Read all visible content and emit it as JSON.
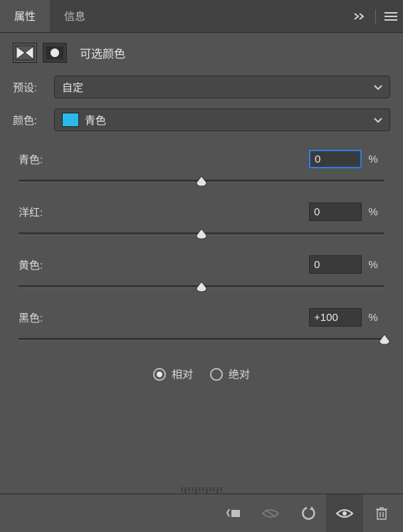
{
  "tabs": {
    "properties": "属性",
    "info": "信息"
  },
  "header": {
    "title": "可选颜色"
  },
  "preset": {
    "label": "预设:",
    "value": "自定"
  },
  "color": {
    "label": "颜色:",
    "value": "青色",
    "swatch": "#2ab9e8"
  },
  "sliders": {
    "cyan": {
      "label": "青色:",
      "value": "0",
      "pct": "%",
      "pos": 50
    },
    "magenta": {
      "label": "洋红:",
      "value": "0",
      "pct": "%",
      "pos": 50
    },
    "yellow": {
      "label": "黄色:",
      "value": "0",
      "pct": "%",
      "pos": 50
    },
    "black": {
      "label": "黑色:",
      "value": "+100",
      "pct": "%",
      "pos": 100
    }
  },
  "method": {
    "relative": "相对",
    "absolute": "绝对",
    "selected": "relative"
  }
}
